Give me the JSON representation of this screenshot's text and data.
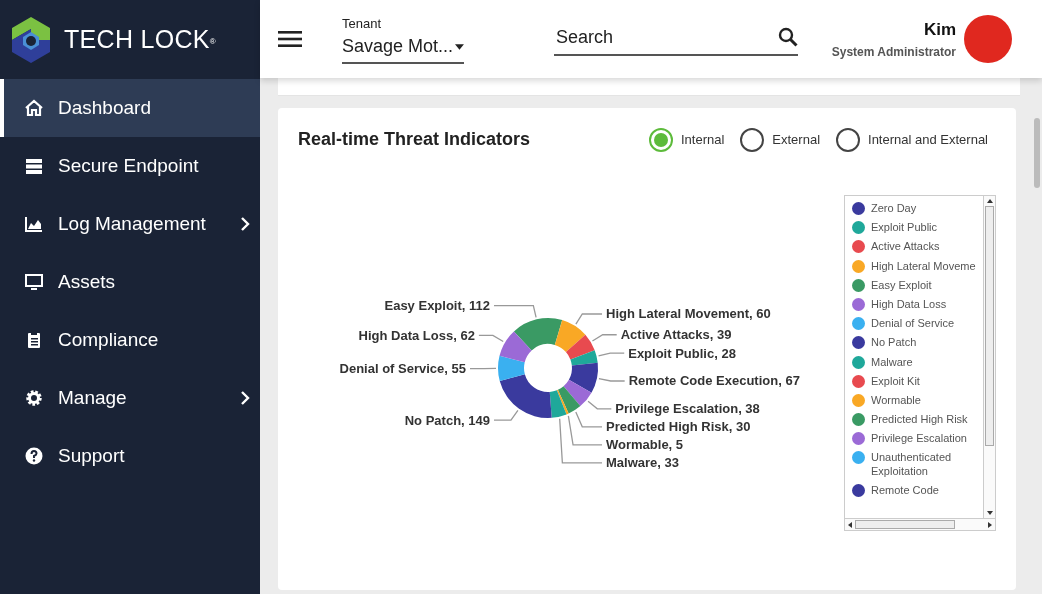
{
  "brand": {
    "name": "TECH LOCK",
    "mark": "®"
  },
  "sidebar": {
    "items": [
      {
        "label": "Dashboard",
        "selected": true,
        "has_submenu": false
      },
      {
        "label": "Secure Endpoint",
        "selected": false,
        "has_submenu": false
      },
      {
        "label": "Log Management",
        "selected": false,
        "has_submenu": true
      },
      {
        "label": "Assets",
        "selected": false,
        "has_submenu": false
      },
      {
        "label": "Compliance",
        "selected": false,
        "has_submenu": false
      },
      {
        "label": "Manage",
        "selected": false,
        "has_submenu": true
      },
      {
        "label": "Support",
        "selected": false,
        "has_submenu": false
      }
    ]
  },
  "header": {
    "tenant_label": "Tenant",
    "tenant_value": "Savage Mot...",
    "search_placeholder": "Search",
    "user_name": "Kim",
    "user_role": "System Administrator"
  },
  "card": {
    "title": "Real-time Threat Indicators",
    "options": [
      {
        "label": "Internal",
        "selected": true
      },
      {
        "label": "External",
        "selected": false
      },
      {
        "label": "Internal and External",
        "selected": false
      }
    ],
    "chart_data": {
      "type": "donut",
      "categories": [
        "Easy Exploit, 112",
        "High Lateral Movement, 60",
        "Active Attacks, 39",
        "Exploit Public, 28",
        "Remote Code Execution, 67",
        "Privilege Escalation, 38",
        "Predicted High Risk, 30",
        "Wormable, 5",
        "Malware, 33",
        "No Patch, 149",
        "Denial of Service, 55",
        "High Data Loss, 62"
      ],
      "series": [
        {
          "colors": [
            "#3a9a64",
            "#f9a825",
            "#e84a4f",
            "#1fa89a",
            "#3a3a9e",
            "#9b6ad6",
            "#3a9a64",
            "#f9a825",
            "#1fa89a",
            "#3a3a9e",
            "#3ab0f0",
            "#9b6ad6"
          ],
          "values": [
            112,
            60,
            39,
            28,
            67,
            38,
            30,
            5,
            33,
            149,
            55,
            62
          ]
        }
      ]
    },
    "legend": [
      {
        "label": "Zero Day",
        "color": "#3a3a9e"
      },
      {
        "label": "Exploit Public",
        "color": "#1fa89a"
      },
      {
        "label": "Active Attacks",
        "color": "#e84a4f"
      },
      {
        "label": "High Lateral Moveme",
        "color": "#f9a825"
      },
      {
        "label": "Easy Exploit",
        "color": "#3a9a64"
      },
      {
        "label": "High Data Loss",
        "color": "#9b6ad6"
      },
      {
        "label": "Denial of Service",
        "color": "#3ab0f0"
      },
      {
        "label": "No Patch",
        "color": "#3a3a9e"
      },
      {
        "label": "Malware",
        "color": "#1fa89a"
      },
      {
        "label": "Exploit Kit",
        "color": "#e84a4f"
      },
      {
        "label": "Wormable",
        "color": "#f9a825"
      },
      {
        "label": "Predicted High Risk",
        "color": "#3a9a64"
      },
      {
        "label": "Privilege Escalation",
        "color": "#9b6ad6"
      },
      {
        "label": "Unauthenticated Exploitation",
        "color": "#3ab0f0"
      },
      {
        "label": "Remote Code",
        "color": "#3a3a9e"
      }
    ]
  }
}
